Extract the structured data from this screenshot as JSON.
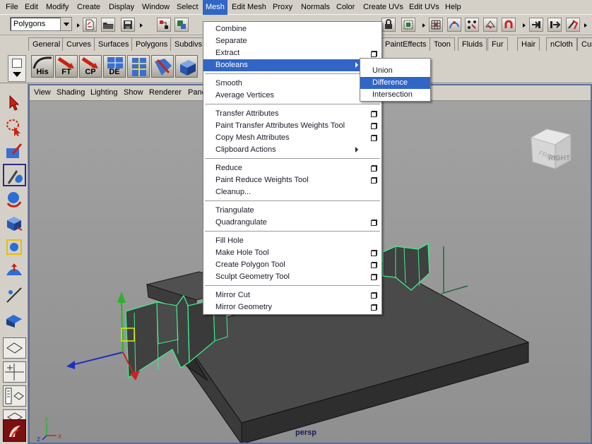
{
  "menubar": {
    "items": [
      "File",
      "Edit",
      "Modify",
      "Create",
      "Display",
      "Window",
      "Select",
      "Mesh",
      "Edit Mesh",
      "Proxy",
      "Normals",
      "Color",
      "Create UVs",
      "Edit UVs",
      "Help"
    ],
    "active": "Mesh"
  },
  "statusline": {
    "mode": "Polygons"
  },
  "shelf": {
    "tabs": [
      "General",
      "Curves",
      "Surfaces",
      "Polygons",
      "Subdivs",
      "PaintEffects",
      "Toon",
      "Fluids",
      "Fur",
      "Hair",
      "nCloth",
      "Cus"
    ],
    "buttons": [
      "His",
      "FT",
      "CP",
      "DE"
    ]
  },
  "viewport": {
    "menus": [
      "View",
      "Shading",
      "Lighting",
      "Show",
      "Renderer",
      "Pane"
    ],
    "camera": "persp",
    "view_cube_label": "RIGHT",
    "view_cube_side": "FRONT",
    "axis_labels": {
      "x": "x",
      "y": "y",
      "z": "z"
    }
  },
  "mesh_menu": {
    "items": [
      {
        "label": "Combine",
        "options": false
      },
      {
        "label": "Separate",
        "options": false
      },
      {
        "label": "Extract",
        "options": true
      },
      {
        "label": "Booleans",
        "options": false,
        "submenu": true,
        "highlighted": true
      },
      {
        "label": "Smooth",
        "options": false
      },
      {
        "label": "Average Vertices",
        "options": false
      },
      {
        "label": "Transfer Attributes",
        "options": true
      },
      {
        "label": "Paint Transfer Attributes Weights Tool",
        "options": true
      },
      {
        "label": "Copy Mesh Attributes",
        "options": true
      },
      {
        "label": "Clipboard Actions",
        "options": false,
        "submenu": true
      },
      {
        "label": "Reduce",
        "options": true
      },
      {
        "label": "Paint Reduce Weights Tool",
        "options": true
      },
      {
        "label": "Cleanup...",
        "options": false
      },
      {
        "label": "Triangulate",
        "options": false
      },
      {
        "label": "Quadrangulate",
        "options": true
      },
      {
        "label": "Fill Hole",
        "options": false
      },
      {
        "label": "Make Hole Tool",
        "options": true
      },
      {
        "label": "Create Polygon Tool",
        "options": true
      },
      {
        "label": "Sculpt Geometry Tool",
        "options": true
      },
      {
        "label": "Mirror Cut",
        "options": true
      },
      {
        "label": "Mirror Geometry",
        "options": true
      }
    ]
  },
  "booleans_submenu": {
    "items": [
      "Union",
      "Difference",
      "Intersection"
    ],
    "highlighted": "Difference"
  },
  "colors": {
    "menu_highlight": "#3165c6",
    "viewport_bg": "#9b9a99",
    "wireframe": "#3cf08a"
  },
  "icons": [
    "arrow-select-icon",
    "lasso-icon",
    "paint-select-icon",
    "move-icon",
    "rotate-icon",
    "scale-icon",
    "universal-manip-icon",
    "soft-mod-icon",
    "show-manip-icon",
    "last-tool-icon"
  ]
}
